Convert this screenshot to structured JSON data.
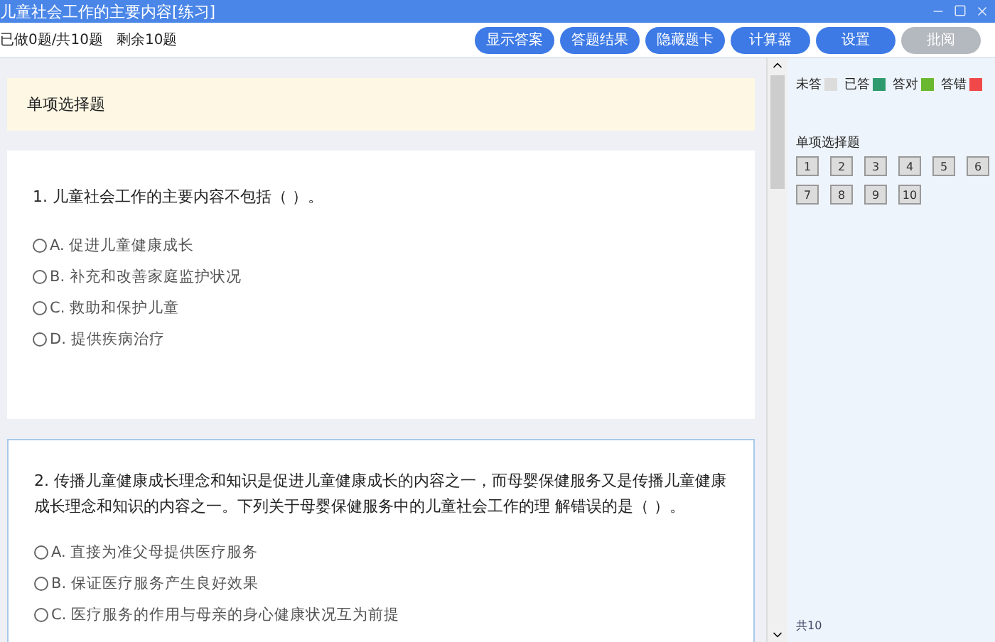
{
  "window": {
    "title": "儿童社会工作的主要内容[练习]"
  },
  "progress": {
    "done": "已做0题/共10题",
    "remaining": "剩余10题"
  },
  "buttons": [
    {
      "label": "显示答案",
      "disabled": false
    },
    {
      "label": "答题结果",
      "disabled": false
    },
    {
      "label": "隐藏题卡",
      "disabled": false
    },
    {
      "label": "计算器",
      "disabled": false
    },
    {
      "label": "设置",
      "disabled": false
    },
    {
      "label": "批阅",
      "disabled": true
    }
  ],
  "section_title": "单项选择题",
  "questions": [
    {
      "stem": "1. 儿童社会工作的主要内容不包括（ ）。",
      "options": [
        {
          "label": "A. 促进儿童健康成长",
          "selected": false
        },
        {
          "label": "B. 补充和改善家庭监护状况",
          "selected": false
        },
        {
          "label": "C. 救助和保护儿童",
          "selected": false
        },
        {
          "label": "D. 提供疾病治疗",
          "selected": false
        }
      ]
    },
    {
      "stem": "2. 传播儿童健康成长理念和知识是促进儿童健康成长的内容之一，而母婴保健服务又是传播儿童健康成长理念和知识的内容之一。下列关于母婴保健服务中的儿童社会工作的理 解错误的是（ ）。",
      "options": [
        {
          "label": "A. 直接为准父母提供医疗服务",
          "selected": false
        },
        {
          "label": "B. 保证医疗服务产生良好效果",
          "selected": false
        },
        {
          "label": "C. 医疗服务的作用与母亲的身心健康状况互为前提",
          "selected": false
        }
      ]
    }
  ],
  "legend": [
    {
      "label": "未答",
      "color": "#dcdcdc"
    },
    {
      "label": "已答",
      "color": "#2e9a6e"
    },
    {
      "label": "答对",
      "color": "#6ab830"
    },
    {
      "label": "答错",
      "color": "#f04848"
    }
  ],
  "card": {
    "title": "单项选择题",
    "numbers": [
      {
        "label": "1",
        "answered": false
      },
      {
        "label": "2",
        "answered": false
      },
      {
        "label": "3",
        "answered": false
      },
      {
        "label": "4",
        "answered": false
      },
      {
        "label": "5",
        "answered": false
      },
      {
        "label": "6",
        "answered": false
      },
      {
        "label": "7",
        "answered": false
      },
      {
        "label": "8",
        "answered": false
      },
      {
        "label": "9",
        "answered": false
      },
      {
        "label": "10",
        "answered": false
      }
    ]
  },
  "footer": "共10"
}
